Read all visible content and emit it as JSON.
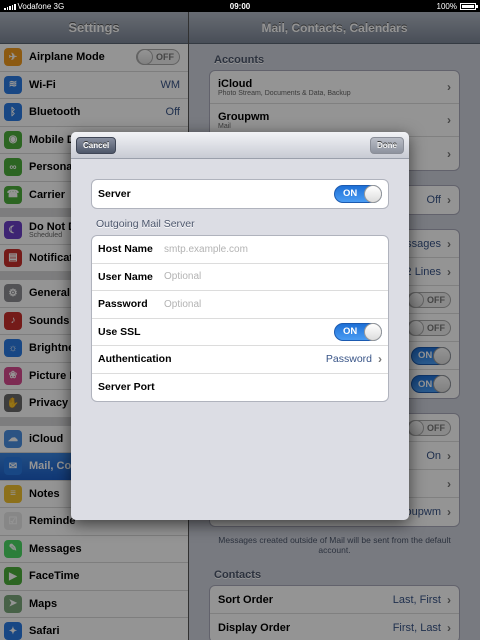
{
  "status": {
    "carrier": "Vodafone 3G",
    "time": "09:00",
    "battery": "100%"
  },
  "master": {
    "title": "Settings",
    "groups": [
      [
        {
          "label": "Airplane Mode",
          "icon": "airplane-icon",
          "color": "#f29b20",
          "toggle": "OFF"
        },
        {
          "label": "Wi-Fi",
          "icon": "wifi-icon",
          "color": "#2a7be4",
          "value": "WM"
        },
        {
          "label": "Bluetooth",
          "icon": "bluetooth-icon",
          "color": "#2a7be4",
          "value": "Off"
        },
        {
          "label": "Mobile D",
          "icon": "antenna-icon",
          "color": "#4cae3c"
        },
        {
          "label": "Persona",
          "icon": "link-icon",
          "color": "#4cae3c"
        },
        {
          "label": "Carrier",
          "icon": "phone-icon",
          "color": "#4cae3c"
        }
      ],
      [
        {
          "label": "Do Not D",
          "sub": "Scheduled",
          "icon": "moon-icon",
          "color": "#6b3fc7"
        },
        {
          "label": "Notificati",
          "icon": "notifications-icon",
          "color": "#c9302c"
        }
      ],
      [
        {
          "label": "General",
          "icon": "gear-icon",
          "color": "#8e8e93"
        },
        {
          "label": "Sounds",
          "icon": "speaker-icon",
          "color": "#c9302c"
        },
        {
          "label": "Brightne",
          "icon": "sun-icon",
          "color": "#2a7be4"
        },
        {
          "label": "Picture F",
          "icon": "flower-icon",
          "color": "#d84a8f"
        },
        {
          "label": "Privacy",
          "icon": "hand-icon",
          "color": "#6a6a6a"
        }
      ],
      [
        {
          "label": "iCloud",
          "icon": "cloud-icon",
          "color": "#4a90e2"
        },
        {
          "label": "Mail, Co",
          "icon": "mail-icon",
          "color": "#2a7be4",
          "selected": true
        },
        {
          "label": "Notes",
          "icon": "notes-icon",
          "color": "#f2c230"
        },
        {
          "label": "Reminde",
          "icon": "reminders-icon",
          "color": "#e8e8e8"
        },
        {
          "label": "Messages",
          "icon": "messages-icon",
          "color": "#4cd964"
        },
        {
          "label": "FaceTime",
          "icon": "facetime-icon",
          "color": "#4cae3c"
        },
        {
          "label": "Maps",
          "icon": "maps-icon",
          "color": "#7aa87a"
        },
        {
          "label": "Safari",
          "icon": "safari-icon",
          "color": "#2a7be4"
        }
      ]
    ]
  },
  "detail": {
    "title": "Mail, Contacts, Calendars",
    "accounts_header": "Accounts",
    "accounts": [
      {
        "label": "iCloud",
        "sub": "Photo Stream, Documents & Data, Backup"
      },
      {
        "label": "Groupwm",
        "sub": "Mail"
      },
      {
        "label": "",
        "sub": ""
      }
    ],
    "fetch_value": "Off",
    "rows": [
      {
        "value": "ssages"
      },
      {
        "value": "2 Lines"
      },
      {
        "toggle": "OFF"
      },
      {
        "toggle": "OFF"
      },
      {
        "toggle": "ON"
      },
      {
        "toggle": "ON"
      }
    ],
    "rows2": [
      {
        "toggle": "OFF"
      },
      {
        "value": "On"
      },
      {
        "value": ""
      },
      {
        "value": "groupwm"
      }
    ],
    "footnote": "Messages created outside of Mail will be sent from the default account.",
    "contacts_header": "Contacts",
    "contacts": [
      {
        "label": "Sort Order",
        "value": "Last, First"
      },
      {
        "label": "Display Order",
        "value": "First, Last"
      }
    ]
  },
  "modal": {
    "cancel_label": "Cancel",
    "done_label": "Done",
    "server_label": "Server",
    "server_toggle": "ON",
    "section_title": "Outgoing Mail Server",
    "host_label": "Host Name",
    "host_placeholder": "smtp.example.com",
    "user_label": "User Name",
    "user_placeholder": "Optional",
    "pass_label": "Password",
    "pass_placeholder": "Optional",
    "ssl_label": "Use SSL",
    "ssl_toggle": "ON",
    "auth_label": "Authentication",
    "auth_value": "Password",
    "port_label": "Server Port"
  }
}
